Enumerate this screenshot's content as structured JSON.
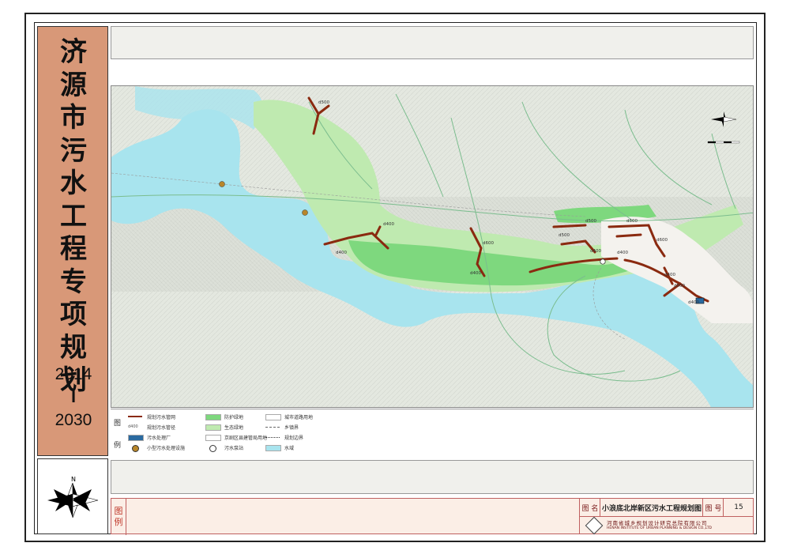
{
  "title_vertical": [
    "济",
    "源",
    "市",
    "污",
    "水",
    "工",
    "程",
    "专",
    "项",
    "规",
    "划"
  ],
  "years": {
    "start": "2014",
    "sep": "I",
    "end": "2030"
  },
  "compass_label": "N",
  "legend": {
    "heading_chars": [
      "图",
      "例"
    ],
    "items": [
      {
        "label": "规划污水管网",
        "color": "#8a2a10",
        "kind": "line"
      },
      {
        "label": "规划污水管径",
        "color": "#555555",
        "kind": "text"
      },
      {
        "label": "污水处理厂",
        "color": "#2a6aa0",
        "kind": "box"
      },
      {
        "label": "小型污水处理设施",
        "color": "#b8862a",
        "kind": "circle"
      },
      {
        "label": "防护绿地",
        "color": "#7ed87e",
        "kind": "fill"
      },
      {
        "label": "生态绿地",
        "color": "#bfeab0",
        "kind": "fill"
      },
      {
        "label": "京剧区县建管局用地",
        "color": "#ffffff",
        "kind": "fill"
      },
      {
        "label": "污水泵站",
        "color": "#333333",
        "kind": "pump"
      },
      {
        "label": "城市道路用地",
        "color": "#ffffff",
        "kind": "fill"
      },
      {
        "label": "乡镇界",
        "color": "#666666",
        "kind": "dash"
      },
      {
        "label": "规划边界",
        "color": "#333333",
        "kind": "dashdot"
      },
      {
        "label": "水域",
        "color": "#a8e4ee",
        "kind": "fill"
      }
    ]
  },
  "pipe_labels": [
    "d500",
    "d400",
    "d400",
    "d600",
    "d400",
    "d500",
    "d400",
    "d500",
    "d500",
    "d600",
    "d400",
    "d400",
    "d500",
    "d400"
  ],
  "title_block": {
    "side_label": [
      "图",
      "例"
    ],
    "name_label": "图 名",
    "name_value": "小浪底北岸新区污水工程规划图",
    "number_label": "图 号",
    "number_value": "15",
    "institute_cn": "河南省城乡规划设计研究总院有限公司",
    "institute_en": "HENAN INSTITUTE OF URBAN PLANNING & DESIGN CO.,LTD"
  },
  "colors": {
    "side_panel": "#d89878",
    "water": "#a8e4ee",
    "green_dark": "#7ed87e",
    "green_light": "#bfeab0",
    "pipe": "#8a2a10",
    "terrain": "#e4e8e0"
  }
}
